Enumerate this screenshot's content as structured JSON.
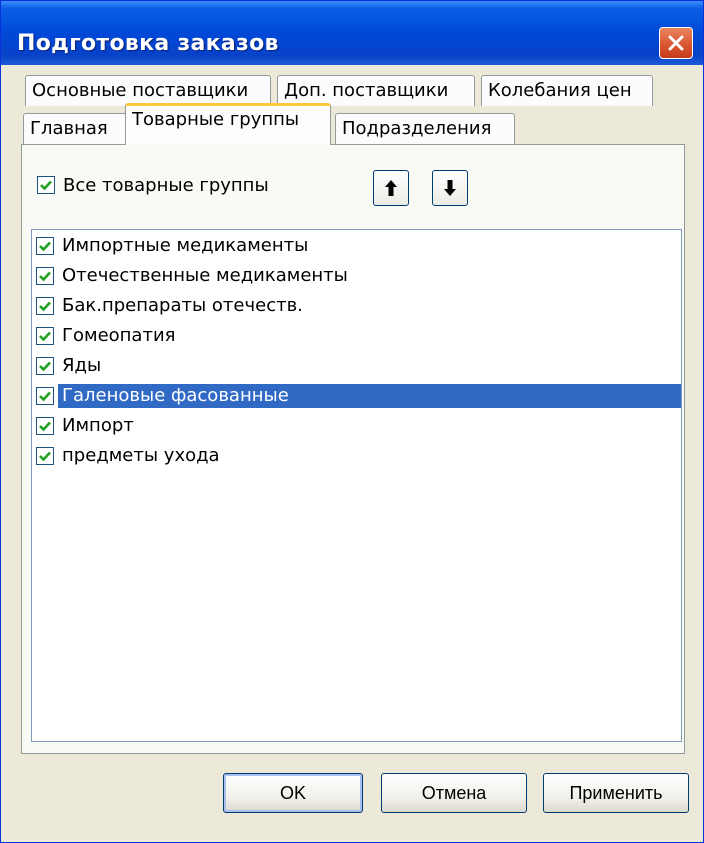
{
  "window": {
    "title": "Подготовка заказов"
  },
  "tabs": {
    "row1": [
      "Основные поставщики",
      "Доп. поставщики",
      "Колебания цен"
    ],
    "row2": [
      "Главная",
      "Товарные группы",
      "Подразделения"
    ],
    "active": "Товарные группы"
  },
  "groups": {
    "all_label": "Все товарные группы",
    "all_checked": true,
    "items": [
      {
        "label": "Импортные медикаменты",
        "checked": true
      },
      {
        "label": "Отечественные медикаменты",
        "checked": true
      },
      {
        "label": "Бак.препараты отечеств.",
        "checked": true
      },
      {
        "label": "Гомеопатия",
        "checked": true
      },
      {
        "label": "Яды",
        "checked": true
      },
      {
        "label": "Галеновые фасованные",
        "checked": true,
        "selected": true
      },
      {
        "label": "Импорт",
        "checked": true
      },
      {
        "label": "предметы ухода",
        "checked": true
      }
    ]
  },
  "buttons": {
    "ok": "OK",
    "cancel": "Отмена",
    "apply": "Применить"
  },
  "colors": {
    "title_bar": "#0049d8",
    "selection": "#316ac5",
    "check": "#21a121",
    "tab_highlight": "#ffc83c"
  }
}
